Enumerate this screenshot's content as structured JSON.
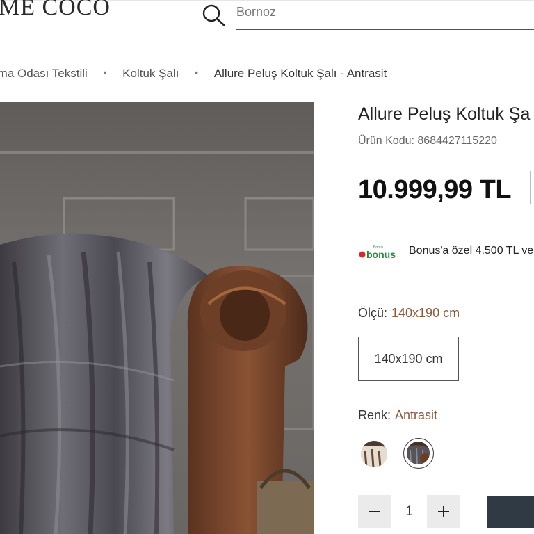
{
  "header": {
    "logo_text": "ME COCO",
    "search": {
      "placeholder": "Bornoz",
      "value": ""
    }
  },
  "breadcrumb": [
    "rma Odası Tekstili",
    "Koltuk Şalı",
    "Allure Peluş Koltuk Şalı - Antrasit"
  ],
  "product": {
    "title": "Allure Peluş Koltuk Şa",
    "sku_label": "Ürün Kodu:",
    "sku_value": "8684427115220",
    "price": "10.999,99 TL",
    "bonus": {
      "logo_small_text": "Bonus",
      "logo_text": "bonus",
      "text": "Bonus'a özel 4.500 TL ve"
    },
    "size": {
      "label": "Ölçü:",
      "selected": "140x190 cm",
      "options": [
        "140x190 cm"
      ]
    },
    "color": {
      "label": "Renk:",
      "selected": "Antrasit",
      "swatches": [
        "swatch-light",
        "swatch-antrasit"
      ]
    },
    "quantity": {
      "value": "1",
      "minus": "−",
      "plus": "+"
    }
  },
  "colors": {
    "accent_value": "#8a5a3c",
    "bonus_green": "#1f8f3a",
    "bonus_red": "#d62828",
    "cart_button": "#2f3a44"
  }
}
